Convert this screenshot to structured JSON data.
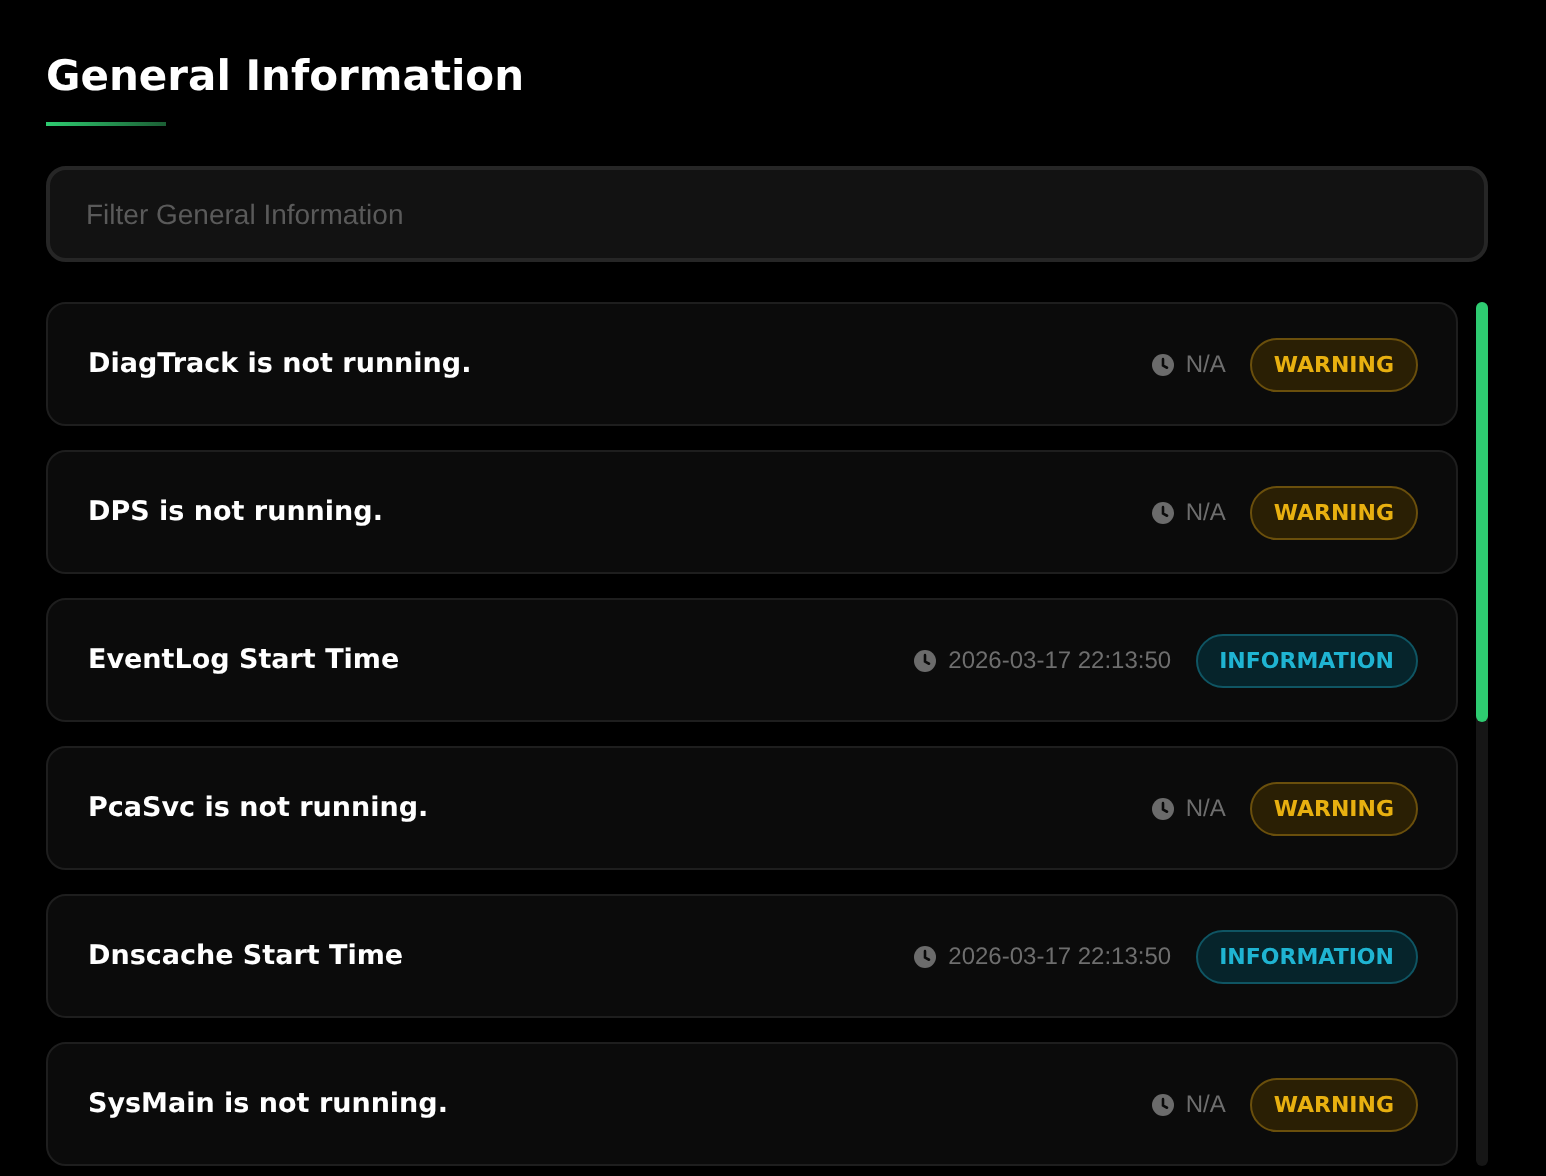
{
  "title": "General Information",
  "filter": {
    "placeholder": "Filter General Information"
  },
  "items": [
    {
      "message": "DiagTrack is not running.",
      "time": "N/A",
      "severity": "WARNING",
      "kind": "warning"
    },
    {
      "message": "DPS is not running.",
      "time": "N/A",
      "severity": "WARNING",
      "kind": "warning"
    },
    {
      "message": "EventLog Start Time",
      "time": "2026-03-17 22:13:50",
      "severity": "INFORMATION",
      "kind": "information"
    },
    {
      "message": "PcaSvc is not running.",
      "time": "N/A",
      "severity": "WARNING",
      "kind": "warning"
    },
    {
      "message": "Dnscache Start Time",
      "time": "2026-03-17 22:13:50",
      "severity": "INFORMATION",
      "kind": "information"
    },
    {
      "message": "SysMain is not running.",
      "time": "N/A",
      "severity": "WARNING",
      "kind": "warning"
    }
  ]
}
